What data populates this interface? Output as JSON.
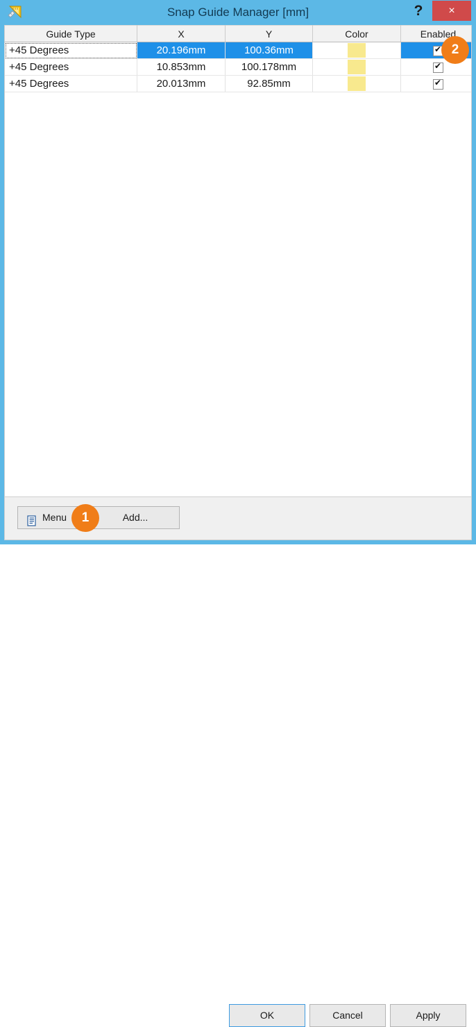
{
  "window": {
    "title": "Snap Guide Manager [mm]",
    "app_icon": "set-square-ruler-icon",
    "help_label": "?",
    "close_label": "×",
    "titlebar_color": "#5cb8e6",
    "accent_color": "#1e90e8",
    "badge_color": "#f07d18"
  },
  "table": {
    "columns": [
      {
        "key": "guide_type",
        "label": "Guide Type"
      },
      {
        "key": "x",
        "label": "X"
      },
      {
        "key": "y",
        "label": "Y"
      },
      {
        "key": "color",
        "label": "Color"
      },
      {
        "key": "enabled",
        "label": "Enabled"
      }
    ],
    "rows": [
      {
        "guide_type": "+45 Degrees",
        "x": "20.196mm",
        "y": "100.36mm",
        "color": "#f8e98e",
        "enabled": true,
        "selected": true
      },
      {
        "guide_type": "+45 Degrees",
        "x": "10.853mm",
        "y": "100.178mm",
        "color": "#f8e98e",
        "enabled": true,
        "selected": false
      },
      {
        "guide_type": "+45 Degrees",
        "x": "20.013mm",
        "y": "92.85mm",
        "color": "#f8e98e",
        "enabled": true,
        "selected": false
      }
    ]
  },
  "footer": {
    "menu_label": "Menu",
    "menu_icon": "list-document-icon",
    "add_label": "Add...",
    "ok_label": "OK",
    "cancel_label": "Cancel",
    "apply_label": "Apply"
  },
  "annotations": [
    {
      "id": "1",
      "target": "menu-button"
    },
    {
      "id": "2",
      "target": "enabled-column-cell"
    }
  ]
}
